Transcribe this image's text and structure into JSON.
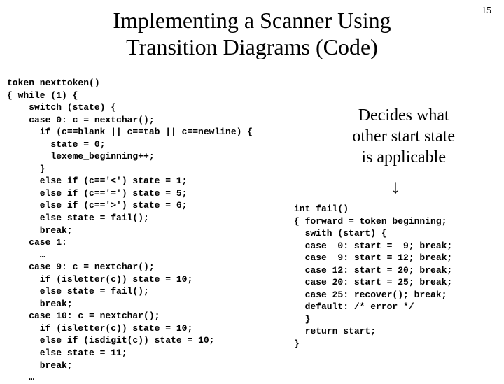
{
  "page_number": "15",
  "title_line1": "Implementing a Scanner Using",
  "title_line2": "Transition Diagrams (Code)",
  "annotation_line1": "Decides what",
  "annotation_line2": "other start state",
  "annotation_line3": "is applicable",
  "code_left": "token nexttoken()\n{ while (1) {\n    switch (state) {\n    case 0: c = nextchar();\n      if (c==blank || c==tab || c==newline) {\n        state = 0;\n        lexeme_beginning++;\n      }\n      else if (c=='<') state = 1;\n      else if (c=='=') state = 5;\n      else if (c=='>') state = 6;\n      else state = fail();\n      break;\n    case 1:\n      …\n    case 9: c = nextchar();\n      if (isletter(c)) state = 10;\n      else state = fail();\n      break;\n    case 10: c = nextchar();\n      if (isletter(c)) state = 10;\n      else if (isdigit(c)) state = 10;\n      else state = 11;\n      break;\n    …",
  "code_right": "int fail()\n{ forward = token_beginning;\n  swith (start) {\n  case  0: start =  9; break;\n  case  9: start = 12; break;\n  case 12: start = 20; break;\n  case 20: start = 25; break;\n  case 25: recover(); break;\n  default: /* error */\n  }\n  return start;\n}"
}
